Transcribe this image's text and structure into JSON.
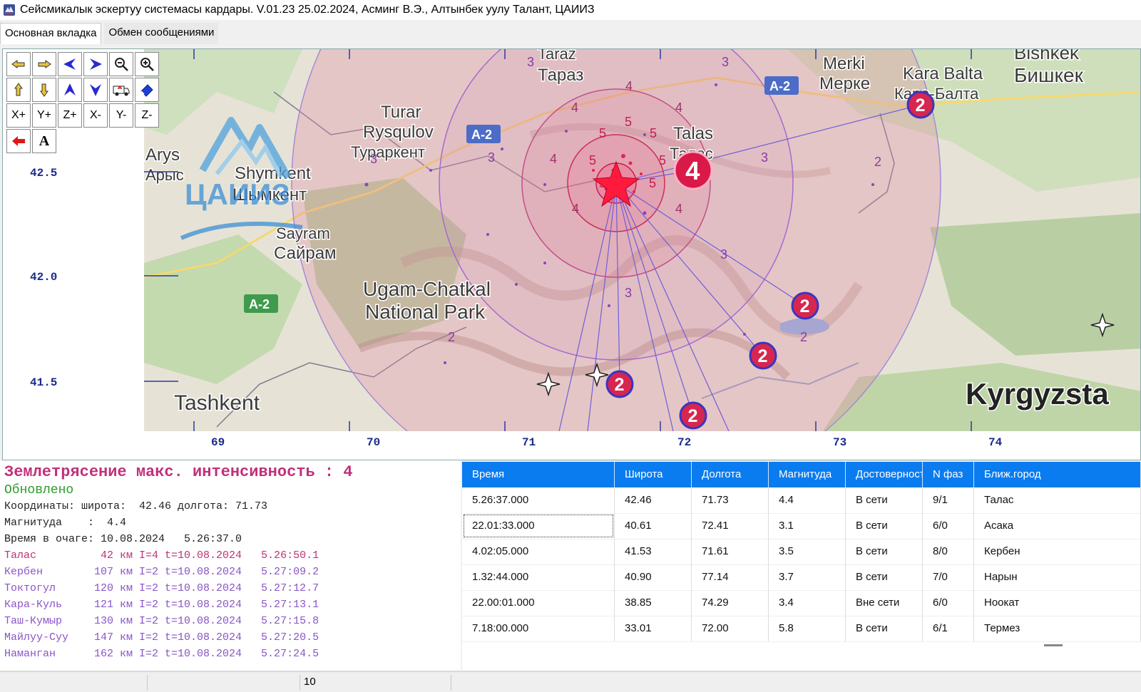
{
  "window": {
    "title": "Сейсмикалык эскертуу системасы кардары. V.01.23 25.02.2024, Асминг В.Э., Алтынбек уулу Талант, ЦАИИЗ"
  },
  "tabs": [
    {
      "label": "Основная вкладка",
      "active": true
    },
    {
      "label": "Обмен сообщениями",
      "active": false
    }
  ],
  "toolbar": {
    "row3": [
      "X+",
      "Y+",
      "Z+",
      "X-",
      "Y-",
      "Z-"
    ],
    "text_tool": "A"
  },
  "map": {
    "lat_labels": [
      "42.5",
      "42.0",
      "41.5"
    ],
    "lon_labels": [
      "69",
      "70",
      "71",
      "72",
      "73",
      "74"
    ],
    "places": [
      {
        "text": "Taraz"
      },
      {
        "text": "Тараз"
      },
      {
        "text": "Merki"
      },
      {
        "text": "Мерке"
      },
      {
        "text": "Kara Balta"
      },
      {
        "text": "Кара-Балта"
      },
      {
        "text": "Bishkek"
      },
      {
        "text": "Бишкек"
      },
      {
        "text": "Turar"
      },
      {
        "text": "Rysqulov"
      },
      {
        "text": "Тураркент"
      },
      {
        "text": "Talas"
      },
      {
        "text": "Талас"
      },
      {
        "text": "Arys"
      },
      {
        "text": "Арыс"
      },
      {
        "text": "Shymkent"
      },
      {
        "text": "Шымкент"
      },
      {
        "text": "Sayram"
      },
      {
        "text": "Сайрам"
      },
      {
        "text": "Ugam-Chatkal"
      },
      {
        "text": "National Park"
      },
      {
        "text": "Tashkent"
      },
      {
        "text": "Kyrgyzsta"
      }
    ],
    "roads": [
      "A-2",
      "A-2",
      "A-2"
    ],
    "logo_text": "ЦАИИЗ",
    "ring_labels": [
      "3",
      "3",
      "3",
      "3",
      "3",
      "3",
      "3",
      "4",
      "4",
      "4",
      "4",
      "4",
      "4",
      "5",
      "5",
      "5",
      "5",
      "5",
      "5",
      "5",
      "2",
      "2",
      "2"
    ],
    "station_badges": [
      "2",
      "4",
      "2",
      "2",
      "2",
      "2"
    ]
  },
  "info": {
    "headline": "Землетрясение макс. интенсивность : 4",
    "status": "Обновлено",
    "coords": "Координаты: широта:  42.46 долгота: 71.73",
    "magnitude": "Магнитуда    :  4.4",
    "origin_time": "Время в очаге: 10.08.2024   5.26:37.0",
    "cities": [
      "Талас          42 км I=4 t=10.08.2024   5.26:50.1",
      "Кербен        107 км I=2 t=10.08.2024   5.27:09.2",
      "Токтогул      120 км I=2 t=10.08.2024   5.27:12.7",
      "Кара-Куль     121 км I=2 t=10.08.2024   5.27:13.1",
      "Таш-Кумыр     130 км I=2 t=10.08.2024   5.27:15.8",
      "Майлуу-Суу    147 км I=2 t=10.08.2024   5.27:20.5",
      "Наманган      162 км I=2 t=10.08.2024   5.27:24.5"
    ],
    "colors": {
      "headline": "#c0307a",
      "status": "#2e9a2e",
      "city_first": "#c0307a",
      "city": "#8a55c8"
    }
  },
  "table": {
    "columns": [
      "Время",
      "Широта",
      "Долгота",
      "Магнитуда",
      "Достоверность",
      "N фаз",
      "Ближ.город"
    ],
    "rows": [
      [
        "5.26:37.000",
        "42.46",
        "71.73",
        "4.4",
        "В сети",
        "9/1",
        "Талас"
      ],
      [
        "22.01:33.000",
        "40.61",
        "72.41",
        "3.1",
        "В сети",
        "6/0",
        "Асака"
      ],
      [
        "4.02:05.000",
        "41.53",
        "71.61",
        "3.5",
        "В сети",
        "8/0",
        "Кербен"
      ],
      [
        "1.32:44.000",
        "40.90",
        "77.14",
        "3.7",
        "В сети",
        "7/0",
        "Нарын"
      ],
      [
        "22.00:01.000",
        "38.85",
        "74.29",
        "3.4",
        "Вне сети",
        "6/0",
        "Ноокат"
      ],
      [
        "7.18:00.000",
        "33.01",
        "72.00",
        "5.8",
        "В сети",
        "6/1",
        "Термез"
      ]
    ],
    "selected_row": 1,
    "header_color": "#0a7cf0"
  },
  "statusbar": {
    "field2": "10"
  }
}
